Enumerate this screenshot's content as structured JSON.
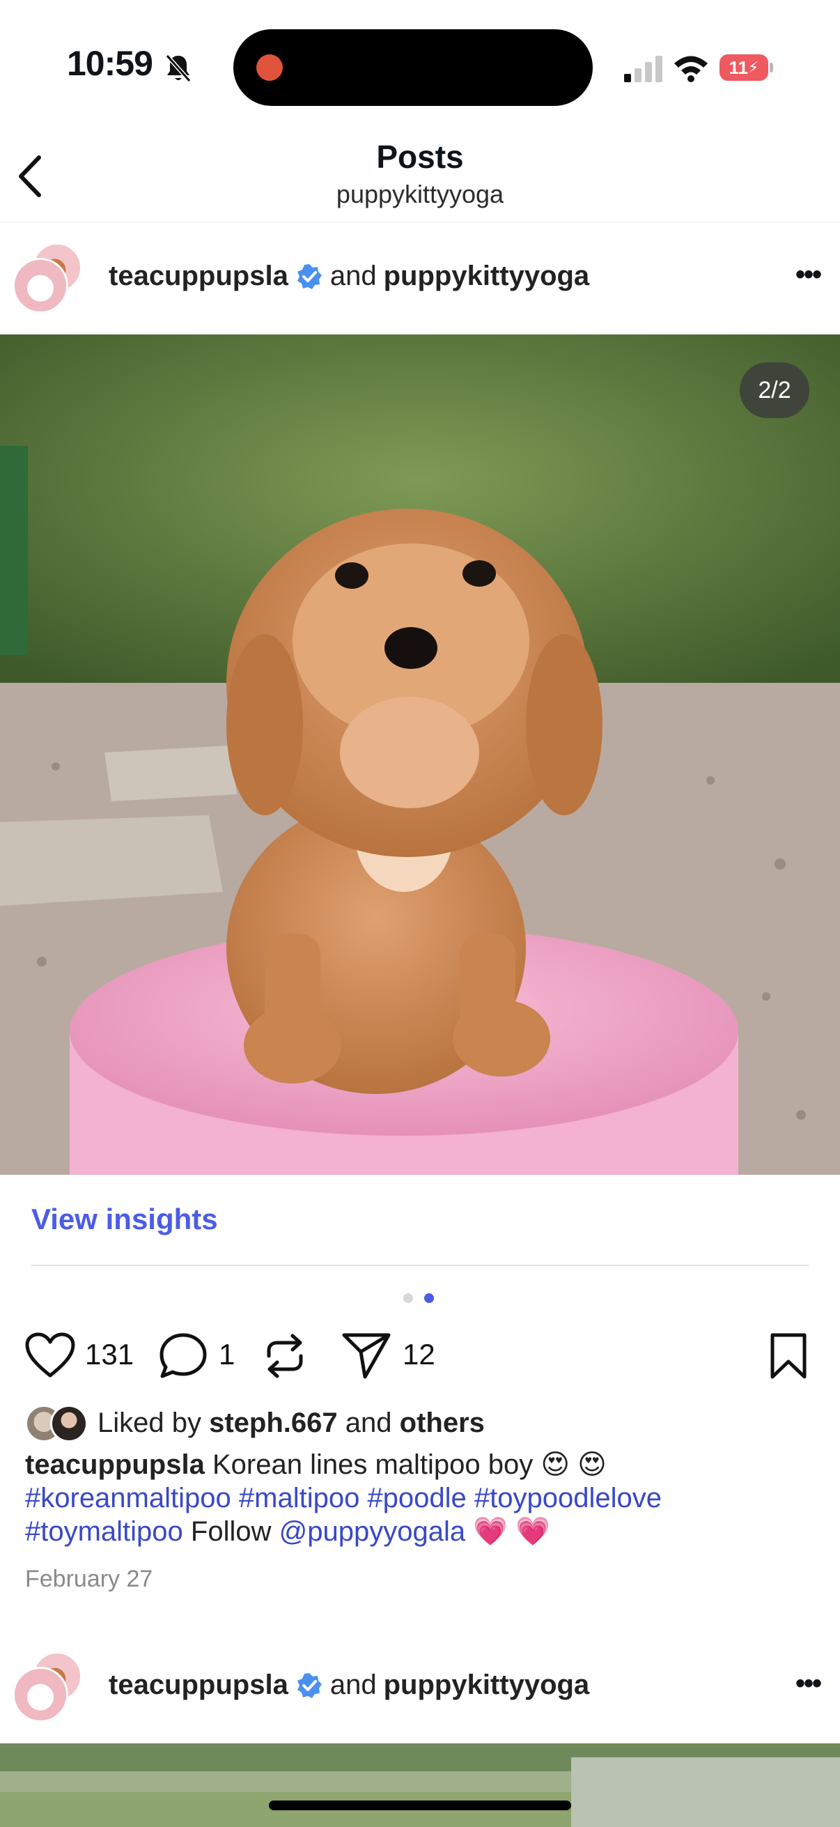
{
  "status_bar": {
    "time": "10:59",
    "battery": "11"
  },
  "header": {
    "title": "Posts",
    "subtitle": "puppykittyyoga"
  },
  "post": {
    "author": "teacuppupsla",
    "joiner": "and",
    "collaborator": "puppykittyyoga",
    "image_counter": "2/2",
    "view_insights": "View insights",
    "likes": "131",
    "comments": "1",
    "shares": "12",
    "liked_by_prefix": "Liked by",
    "liked_by_user": "steph.667",
    "liked_by_and": "and",
    "liked_by_others": "others",
    "caption_author": "teacuppupsla",
    "caption_text": "Korean lines maltipoo boy 😍 😍",
    "hashtags": [
      "#koreanmaltipoo",
      "#maltipoo",
      "#poodle",
      "#toypoodlelove",
      "#toymaltipoo"
    ],
    "follow_text": "Follow",
    "mention": "@puppyyogala",
    "caption_end": "💗 💗",
    "date": "February 27"
  },
  "next_post": {
    "author": "teacuppupsla",
    "joiner": "and",
    "collaborator": "puppykittyyoga"
  },
  "colors": {
    "link": "#4c5ce6",
    "hashtag": "#3948c7",
    "verified": "#4a90f0",
    "battery_low": "#ee5a5f"
  }
}
